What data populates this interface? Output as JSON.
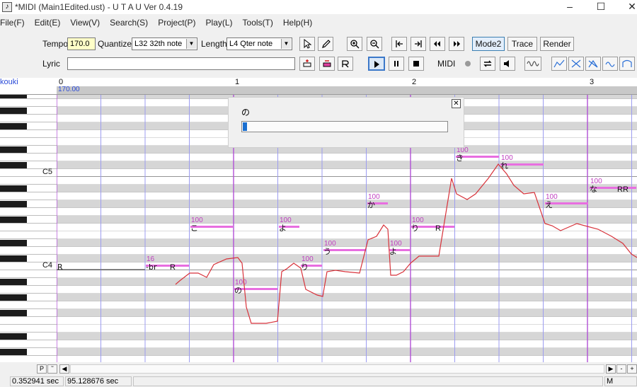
{
  "window": {
    "title": "*MIDI (Main1Edited.ust) - U T A U  Ver 0.4.19",
    "controls": [
      "–",
      "☐",
      "✕"
    ]
  },
  "menu": [
    "File(F)",
    "Edit(E)",
    "View(V)",
    "Search(S)",
    "Project(P)",
    "Play(L)",
    "Tools(T)",
    "Help(H)"
  ],
  "toolbar": {
    "tempo_label": "Tempo",
    "tempo_value": "170.0",
    "quantize_label": "Quantize",
    "quantize_value": "L32 32th note",
    "length_label": "Length",
    "length_value": "L4  Qter note",
    "lyric_label": "Lyric",
    "lyric_value": "",
    "mode2_label": "Mode2",
    "trace_label": "Trace",
    "render_label": "Render",
    "midi_label": "MIDI"
  },
  "ruler": {
    "singer": "kouki",
    "tempo": "170.00",
    "bars": [
      "0",
      "1",
      "2",
      "3"
    ]
  },
  "keyboard": {
    "c5_label": "C5",
    "c4_label": "C4"
  },
  "notes": [
    {
      "lyric": "R",
      "velocity": "",
      "label": "R"
    },
    {
      "lyric": "-br",
      "velocity": "16",
      "label": "R"
    },
    {
      "lyric": "こ",
      "velocity": "100"
    },
    {
      "lyric": "の",
      "velocity": "100"
    },
    {
      "lyric": "よ",
      "velocity": "100"
    },
    {
      "lyric": "り",
      "velocity": "100"
    },
    {
      "lyric": "う",
      "velocity": "100"
    },
    {
      "lyric": "か",
      "velocity": "100"
    },
    {
      "lyric": "よ",
      "velocity": "100"
    },
    {
      "lyric": "り",
      "velocity": "100",
      "label": "R"
    },
    {
      "lyric": "き",
      "velocity": "100"
    },
    {
      "lyric": "れ",
      "velocity": "100"
    },
    {
      "lyric": "え",
      "velocity": "100"
    },
    {
      "lyric": "な",
      "velocity": "100",
      "label": "RR"
    }
  ],
  "progress": {
    "text": "の",
    "fraction": 0.02
  },
  "scrollbar": {
    "p_label": "P",
    "caret_label": "˜",
    "minus_label": "-",
    "plus_label": "+"
  },
  "status": {
    "time1": "0.352941 sec",
    "time2": "95.128676 sec",
    "mode": "M"
  }
}
